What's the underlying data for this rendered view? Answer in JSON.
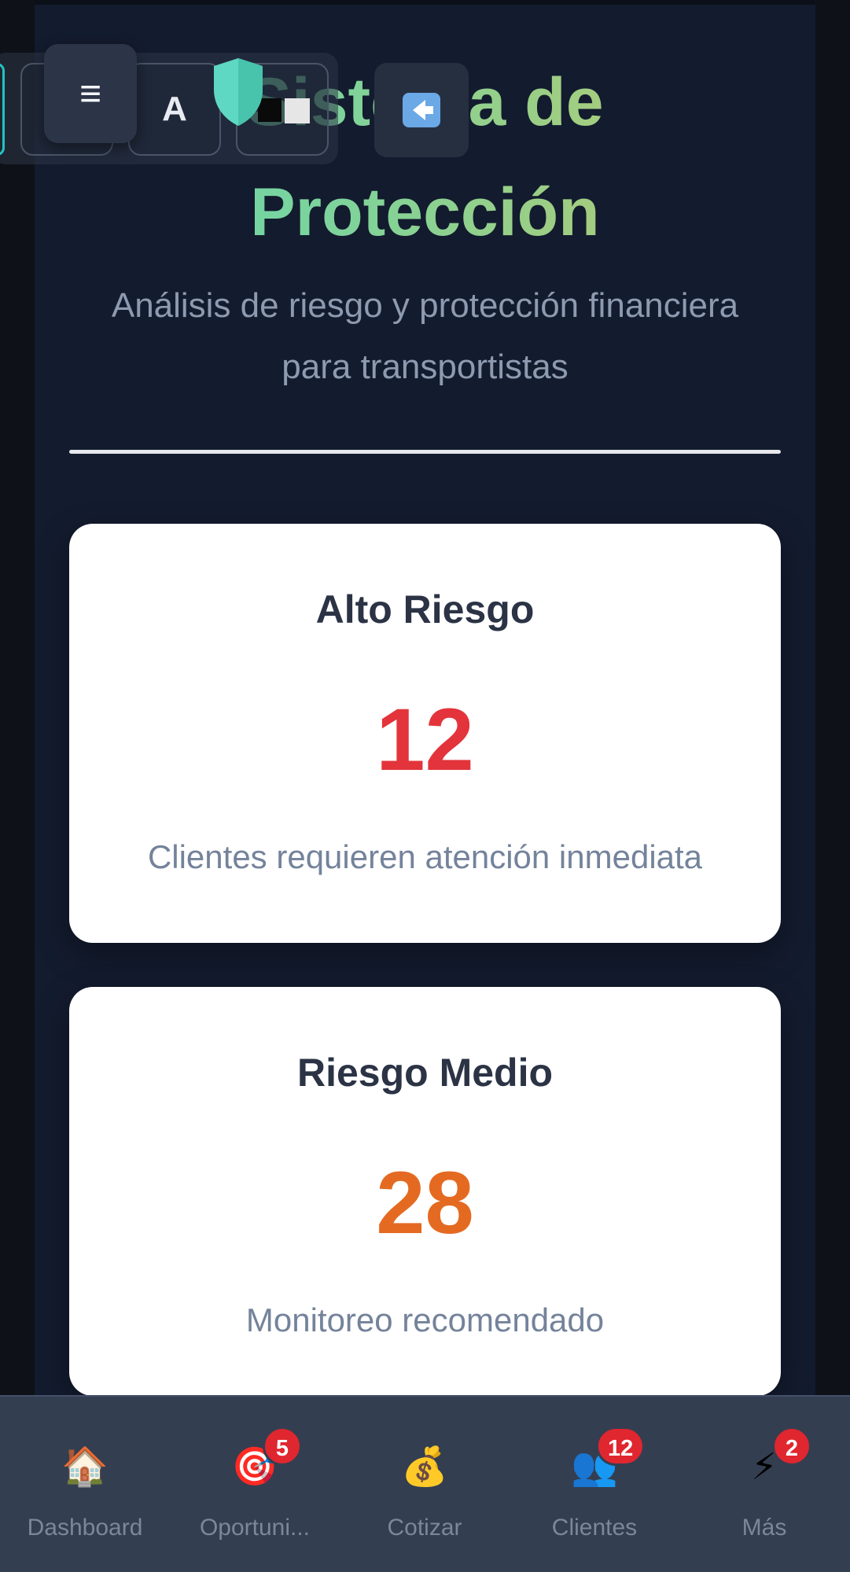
{
  "header": {
    "title": "Sistema de Protección",
    "subtitle": "Análisis de riesgo y protección financiera para transportistas"
  },
  "toolbar": {
    "menu_icon": "hamburger-icon",
    "menu_glyph": "≡",
    "font_button_label": "A",
    "contrast_icon": "contrast-icon",
    "back_icon": "back-arrow-icon"
  },
  "cards": [
    {
      "title": "Alto Riesgo",
      "value": "12",
      "description": "Clientes requieren atención inmediata",
      "color": "#e3343b"
    },
    {
      "title": "Riesgo Medio",
      "value": "28",
      "description": "Monitoreo recomendado",
      "color": "#e46a22"
    }
  ],
  "bottom_nav": {
    "items": [
      {
        "label": "Dashboard",
        "icon": "house-icon",
        "glyph": "🏠",
        "badge": ""
      },
      {
        "label": "Oportuni...",
        "icon": "target-icon",
        "glyph": "🎯",
        "badge": "5"
      },
      {
        "label": "Cotizar",
        "icon": "money-bag-icon",
        "glyph": "💰",
        "badge": ""
      },
      {
        "label": "Clientes",
        "icon": "users-icon",
        "glyph": "👥",
        "badge": "12"
      },
      {
        "label": "Más",
        "icon": "lightning-icon",
        "glyph": "⚡",
        "badge": "2"
      }
    ]
  },
  "colors": {
    "background": "#131b2e",
    "title_gradient_start": "#5fd6b3",
    "title_gradient_end": "#c2c869",
    "badge": "#e0262f"
  }
}
